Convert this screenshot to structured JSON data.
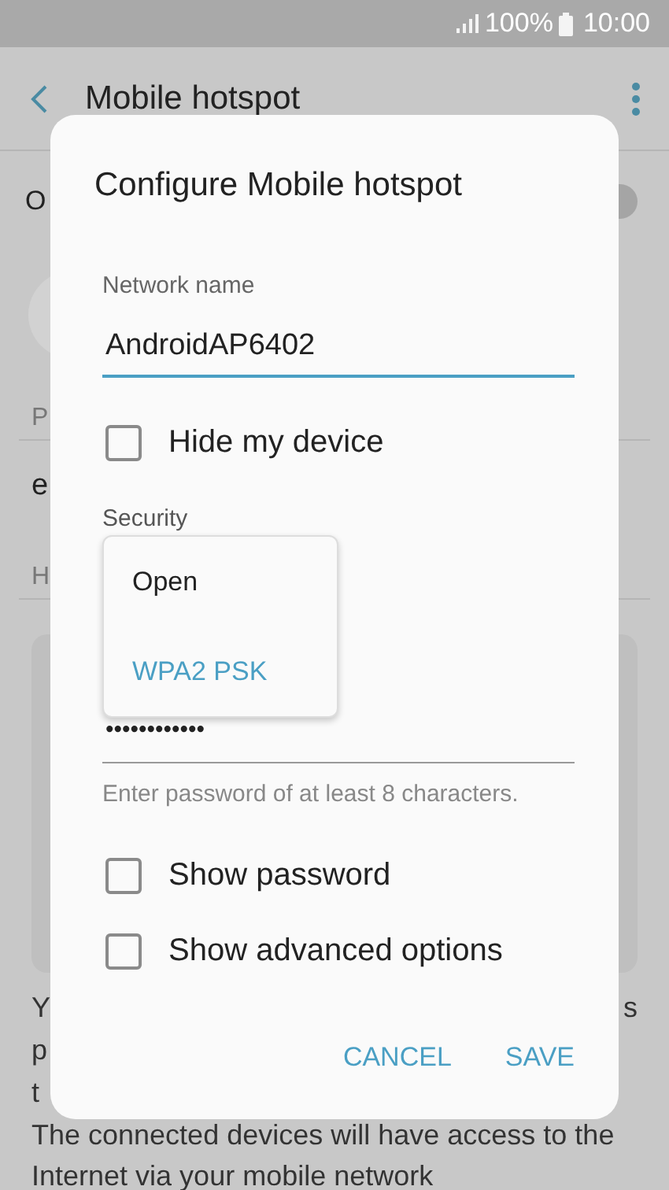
{
  "status_bar": {
    "battery": "100%",
    "time": "10:00"
  },
  "app_bar": {
    "title": "Mobile hotspot"
  },
  "background": {
    "row_1": "O",
    "toggle": {
      "on": false
    },
    "section_1": "P",
    "row_2": "e",
    "section_2": "H",
    "paragraph_1": [
      {
        "left": "Y",
        "right": "s"
      },
      {
        "left": "p"
      },
      {
        "left": "t"
      }
    ],
    "paragraph_2": [
      "The connected devices will have access to the",
      "Internet via your mobile network"
    ]
  },
  "dialog": {
    "title": "Configure Mobile hotspot",
    "network_name": {
      "label": "Network name",
      "value": "AndroidAP6402"
    },
    "hide_device": {
      "label": "Hide my device",
      "checked": false
    },
    "security": {
      "label": "Security",
      "options": [
        {
          "label": "Open",
          "selected": false
        },
        {
          "label": "WPA2 PSK",
          "selected": true
        }
      ]
    },
    "password": {
      "value": "••••••••••••",
      "hint": "Enter password of at least 8 characters."
    },
    "options": [
      {
        "label": "Show password",
        "checked": false
      },
      {
        "label": "Show advanced options",
        "checked": false
      }
    ],
    "buttons": [
      "CANCEL",
      "SAVE"
    ]
  }
}
